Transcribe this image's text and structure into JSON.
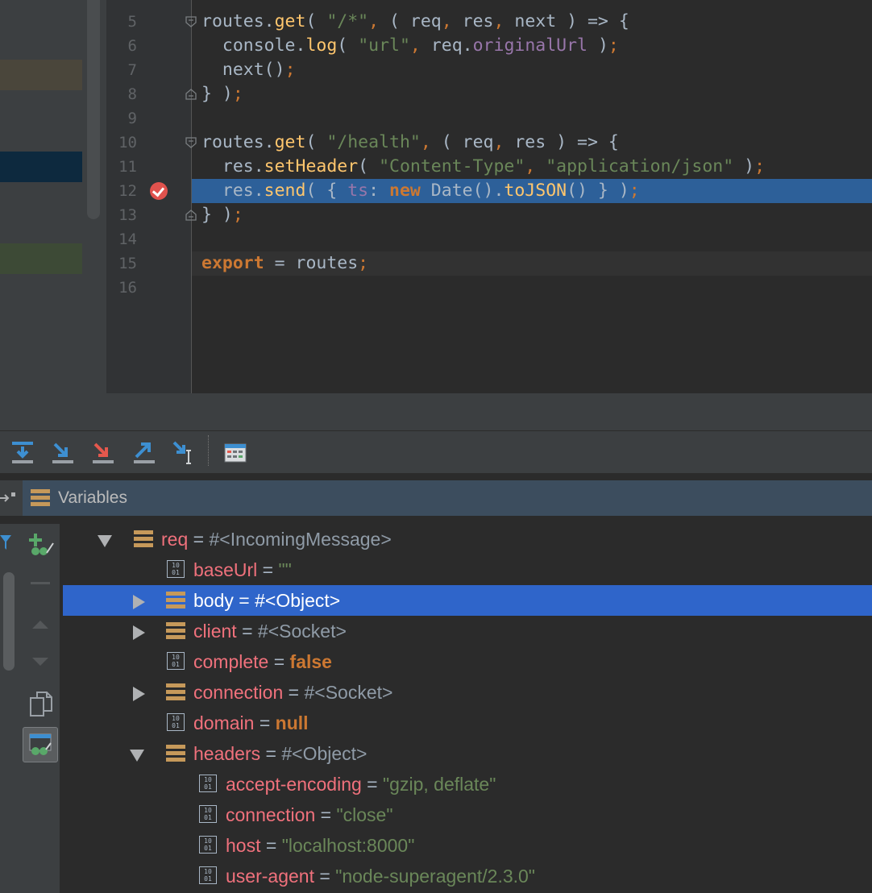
{
  "editor": {
    "lines": [
      {
        "num": "5",
        "tokens": [
          [
            "t-def",
            "routes."
          ],
          [
            "t-fn",
            "get"
          ],
          [
            "t-def",
            "( "
          ],
          [
            "t-str",
            "\"/*\""
          ],
          [
            "t-p",
            ","
          ],
          [
            "t-def",
            " ( req"
          ],
          [
            "t-p",
            ","
          ],
          [
            "t-def",
            " res"
          ],
          [
            "t-p",
            ","
          ],
          [
            "t-def",
            " next ) => {"
          ]
        ]
      },
      {
        "num": "6",
        "tokens": [
          [
            "t-def",
            "  console."
          ],
          [
            "t-fn",
            "log"
          ],
          [
            "t-def",
            "( "
          ],
          [
            "t-str",
            "\"url\""
          ],
          [
            "t-p",
            ","
          ],
          [
            "t-def",
            " req."
          ],
          [
            "t-prop",
            "originalUrl"
          ],
          [
            "t-def",
            " )"
          ],
          [
            "t-p",
            ";"
          ]
        ]
      },
      {
        "num": "7",
        "tokens": [
          [
            "t-def",
            "  next()"
          ],
          [
            "t-p",
            ";"
          ]
        ]
      },
      {
        "num": "8",
        "tokens": [
          [
            "t-def",
            "} )"
          ],
          [
            "t-p",
            ";"
          ]
        ]
      },
      {
        "num": "9",
        "tokens": []
      },
      {
        "num": "10",
        "tokens": [
          [
            "t-def",
            "routes."
          ],
          [
            "t-fn",
            "get"
          ],
          [
            "t-def",
            "( "
          ],
          [
            "t-str",
            "\"/health\""
          ],
          [
            "t-p",
            ","
          ],
          [
            "t-def",
            " ( req"
          ],
          [
            "t-p",
            ","
          ],
          [
            "t-def",
            " res ) => {"
          ]
        ]
      },
      {
        "num": "11",
        "tokens": [
          [
            "t-def",
            "  res."
          ],
          [
            "t-fn",
            "setHeader"
          ],
          [
            "t-def",
            "( "
          ],
          [
            "t-str",
            "\"Content-Type\""
          ],
          [
            "t-p",
            ","
          ],
          [
            "t-def",
            " "
          ],
          [
            "t-str",
            "\"application/json\""
          ],
          [
            "t-def",
            " )"
          ],
          [
            "t-p",
            ";"
          ]
        ]
      },
      {
        "num": "12",
        "tokens": [
          [
            "t-def",
            "  res."
          ],
          [
            "t-fn",
            "send"
          ],
          [
            "t-def",
            "( { "
          ],
          [
            "t-prop",
            "ts"
          ],
          [
            "t-def",
            ": "
          ],
          [
            "t-kw",
            "new"
          ],
          [
            "t-def",
            " Date()."
          ],
          [
            "t-fn",
            "toJSON"
          ],
          [
            "t-def",
            "() } )"
          ],
          [
            "t-p",
            ";"
          ]
        ]
      },
      {
        "num": "13",
        "tokens": [
          [
            "t-def",
            "} )"
          ],
          [
            "t-p",
            ";"
          ]
        ]
      },
      {
        "num": "14",
        "tokens": []
      },
      {
        "num": "15",
        "tokens": [
          [
            "t-kw",
            "export"
          ],
          [
            "t-def",
            " = routes"
          ],
          [
            "t-p",
            ";"
          ]
        ]
      },
      {
        "num": "16",
        "tokens": []
      }
    ]
  },
  "variables": {
    "title": "Variables",
    "rows": [
      {
        "name": "req",
        "eq": " = ",
        "value": "#<IncomingMessage>",
        "vtype": "obj",
        "icon": "object-icon",
        "arrow": "down",
        "level": 0
      },
      {
        "name": "baseUrl",
        "eq": " = ",
        "value": "\"\"",
        "vtype": "str",
        "icon": "primitive-icon",
        "arrow": "",
        "level": 1
      },
      {
        "name": "body",
        "eq": " = ",
        "value": "#<Object>",
        "vtype": "obj",
        "icon": "object-icon",
        "arrow": "right",
        "level": 1,
        "selected": true
      },
      {
        "name": "client",
        "eq": " = ",
        "value": "#<Socket>",
        "vtype": "obj",
        "icon": "object-icon",
        "arrow": "right",
        "level": 1
      },
      {
        "name": "complete",
        "eq": " = ",
        "value": "false",
        "vtype": "kw",
        "icon": "primitive-icon",
        "arrow": "",
        "level": 1
      },
      {
        "name": "connection",
        "eq": " = ",
        "value": "#<Socket>",
        "vtype": "obj",
        "icon": "object-icon",
        "arrow": "right",
        "level": 1
      },
      {
        "name": "domain",
        "eq": " = ",
        "value": "null",
        "vtype": "kw",
        "icon": "primitive-icon",
        "arrow": "",
        "level": 1
      },
      {
        "name": "headers",
        "eq": " = ",
        "value": "#<Object>",
        "vtype": "obj",
        "icon": "object-icon",
        "arrow": "down",
        "level": 1
      },
      {
        "name": "accept-encoding",
        "eq": " = ",
        "value": "\"gzip, deflate\"",
        "vtype": "str",
        "icon": "primitive-icon",
        "arrow": "",
        "level": 2
      },
      {
        "name": "connection",
        "eq": " = ",
        "value": "\"close\"",
        "vtype": "str",
        "icon": "primitive-icon",
        "arrow": "",
        "level": 2
      },
      {
        "name": "host",
        "eq": " = ",
        "value": "\"localhost:8000\"",
        "vtype": "str",
        "icon": "primitive-icon",
        "arrow": "",
        "level": 2
      },
      {
        "name": "user-agent",
        "eq": " = ",
        "value": "\"node-superagent/2.3.0\"",
        "vtype": "str",
        "icon": "primitive-icon",
        "arrow": "",
        "level": 2
      }
    ]
  },
  "toolbar": {
    "buttons": [
      {
        "name": "step-over-button",
        "icon": "step-over-icon"
      },
      {
        "name": "step-into-button",
        "icon": "step-into-icon"
      },
      {
        "name": "force-step-into-button",
        "icon": "force-step-into-icon"
      },
      {
        "name": "step-out-button",
        "icon": "step-out-icon"
      },
      {
        "name": "run-to-cursor-button",
        "icon": "run-to-cursor-icon"
      },
      {
        "name": "evaluate-expression-button",
        "icon": "calculator-icon"
      }
    ]
  },
  "colors": {
    "exec_line": "#2d6099",
    "selected_row": "#2f65ca",
    "breakpoint": "#e0524d"
  }
}
